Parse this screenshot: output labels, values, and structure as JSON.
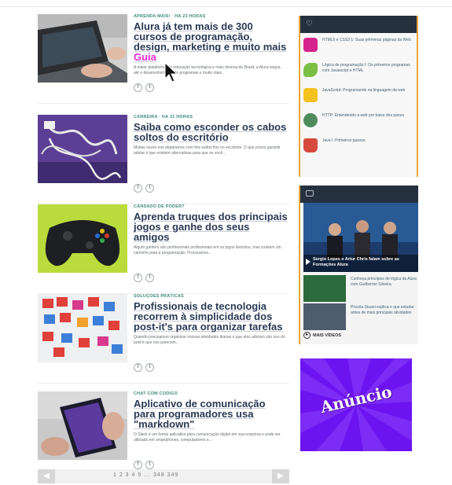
{
  "articles": [
    {
      "kicker": "APRENDA MAIS! · HÁ 23 HORAS",
      "title": "Alura já tem mais de 300 cursos de programação, design, marketing e muito mais",
      "title_highlight": "Guia",
      "summary": "A maior plataforma de educação tecnológica e mais diversa do Brasil, a Alura segue, até o desenvolvimento de programas e muito mais."
    },
    {
      "kicker": "CARREIRA · HÁ 21 HORAS",
      "title": "Saiba como esconder os cabos soltos do escritório",
      "summary": "Muitas vezes nos deparamos com fios soltos fios no escritório. O que posso garantir adotar é que existem alternativas para que se você..."
    },
    {
      "kicker": "CANSADO DE PODER?",
      "title": "Aprenda truques dos principais jogos e ganhe dos seus amigos",
      "summary": "Algum gamers são profissionais profissionais em os jogos favoritos, mas existem um caminho para a programação. Procuramos..."
    },
    {
      "kicker": "SOLUÇÕES PRÁTICAS",
      "title": "Profissionais de tecnologia recorrem à simplicidade dos post-it's para organizar tarefas",
      "summary": "Quando precisamos organizar nossas atividades diárias o que eles adotam são uso do post-it que nos parecem..."
    },
    {
      "kicker": "CHAT COM CÓDIGO",
      "title": "Aplicativo de comunicação para programadores usa \"markdown\"",
      "summary": "O Slack é um forma aplicativo para comunicação digital em sua empresa e pode ser utilizado em smartphones, computadores e..."
    }
  ],
  "share_icons": [
    "facebook-icon",
    "twitter-icon"
  ],
  "pagination": {
    "prev": "◀",
    "next": "▶",
    "pages": "1  2  3  4  5  ...  348  349"
  },
  "widget_popular": {
    "items": [
      {
        "text": "HTML5 e CSS3 1: Suas primeiras páginas da Web",
        "color": "#d6248d"
      },
      {
        "text": "Lógica de programação I: Os primeiros programas com Javascript e HTML",
        "color": "#7cbf45"
      },
      {
        "text": "JavaScript: Programando na linguagem da web",
        "color": "#f3c21f"
      },
      {
        "text": "HTTP: Entendendo a web por baixo dos panos",
        "color": "#4e8b5c"
      },
      {
        "text": "Java I: Primeiros passos",
        "color": "#d64a3b"
      }
    ]
  },
  "widget_videos": {
    "featured_caption": "Sergio Lopes e Artur Chris falam sobre as Formações Alura",
    "items": [
      {
        "text": "Conheça princípios de lógica da Alura com Guilherme Silveira"
      },
      {
        "text": "Priscila Stuani explica o que estudar antes de mais principais atividades"
      }
    ],
    "more_label": "MAIS VÍDEOS"
  },
  "ad": {
    "label": "Anúncio"
  },
  "colors": {
    "headline": "#2a3a55",
    "kicker": "#3e8c7b",
    "widget_header": "#26313f",
    "widget_border": "#e9a63a",
    "ad_background": "#6c14f0",
    "highlight": "#e92bd3"
  }
}
